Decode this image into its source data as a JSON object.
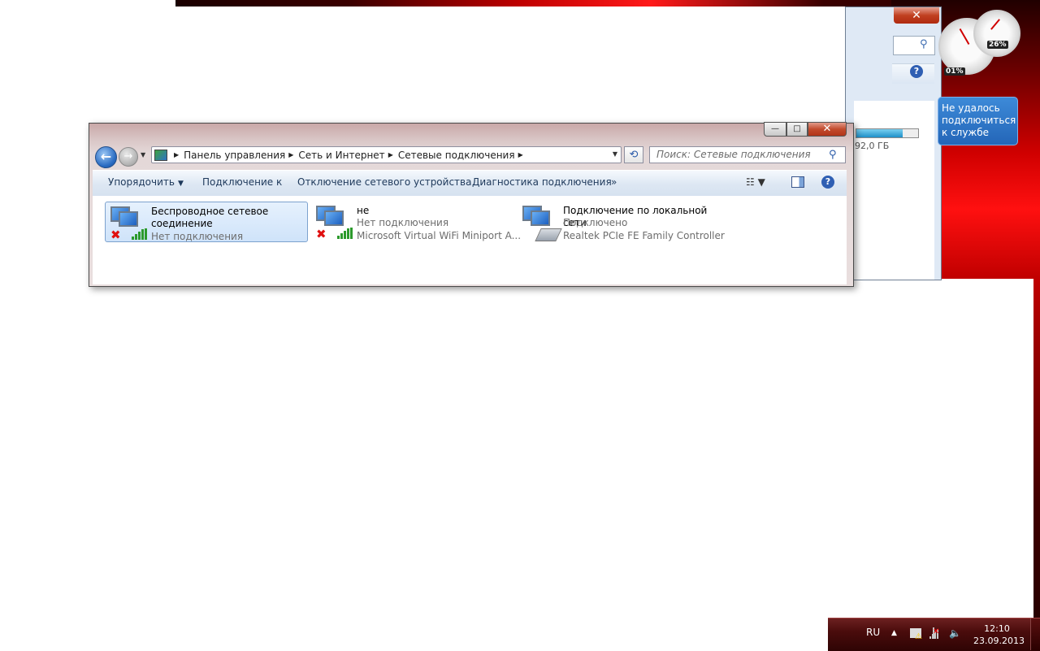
{
  "background_window": {
    "close_label": "✕",
    "drive_free": "92,0 ГБ",
    "drive_fill_percent": 75
  },
  "gadgets": {
    "cpu_percent": "01%",
    "mem_percent": "26%",
    "error_message": "Не удалось подключиться к службе"
  },
  "window": {
    "caption": {
      "minimize": "—",
      "maximize": "□",
      "close": "✕"
    },
    "address": {
      "crumbs": [
        "Панель управления",
        "Сеть и Интернет",
        "Сетевые подключения"
      ]
    },
    "search_placeholder": "Поиск: Сетевые подключения",
    "toolbar": {
      "organize": "Упорядочить",
      "connect_to": "Подключение к",
      "disable_device": "Отключение сетевого устройства",
      "diagnose": "Диагностика подключения",
      "more": "»"
    },
    "items": [
      {
        "name_line1": "Беспроводное сетевое",
        "name_line2": "соединение",
        "status": "Нет подключения",
        "device": "",
        "kind": "wireless",
        "connected": false,
        "selected": true
      },
      {
        "name_line1": "не",
        "status": "Нет подключения",
        "device": "Microsoft Virtual WiFi Miniport A...",
        "kind": "wireless",
        "connected": false,
        "selected": false
      },
      {
        "name_line1": "Подключение по локальной сети",
        "status": "Подключено",
        "device": "Realtek PCIe FE Family Controller",
        "kind": "ethernet",
        "connected": true,
        "selected": false
      }
    ]
  },
  "taskbar": {
    "language": "RU",
    "time": "12:10",
    "date": "23.09.2013"
  },
  "colors": {
    "wallpaper_red": "#d00000",
    "selection_bg": "#cfe3fa",
    "taskbar": "#4a0c0c"
  }
}
